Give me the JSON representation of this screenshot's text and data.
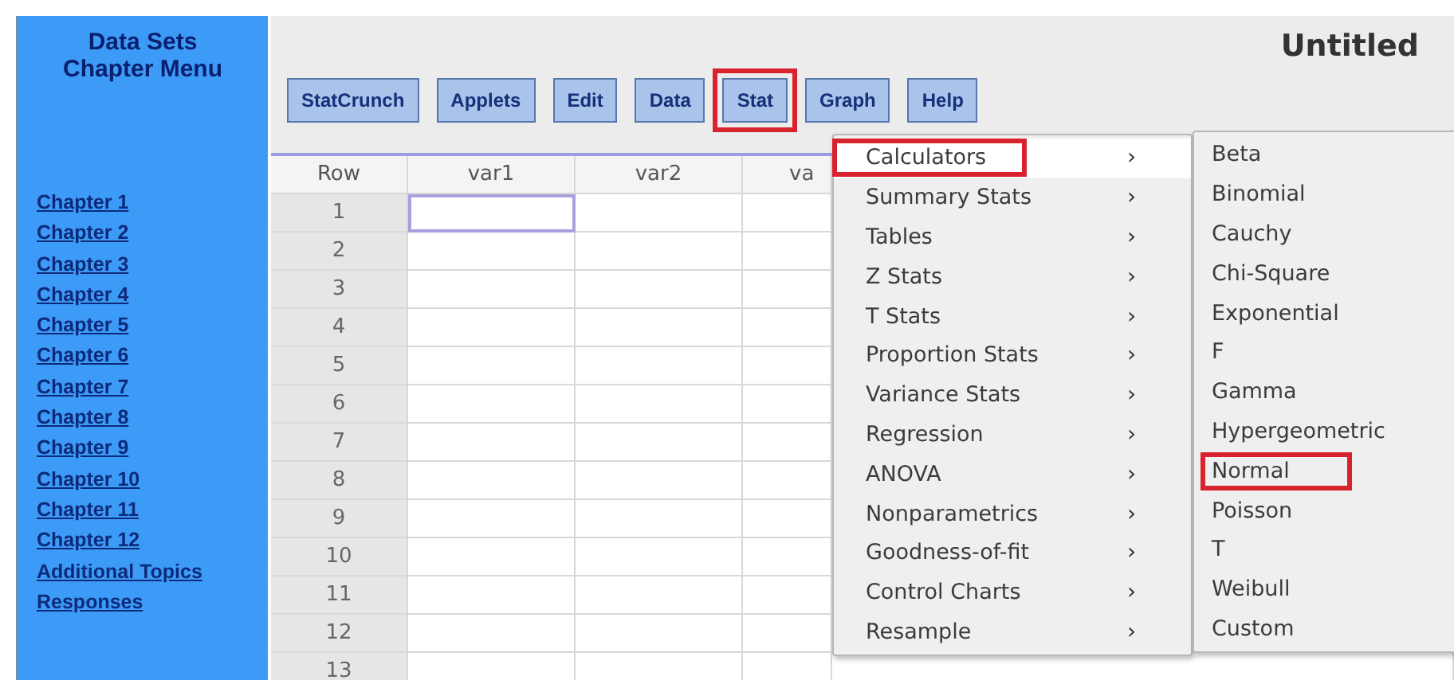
{
  "sidebar": {
    "title": "Data Sets\nChapter Menu",
    "links": [
      {
        "label": "Chapter 1"
      },
      {
        "label": "Chapter 2"
      },
      {
        "label": "Chapter 3"
      },
      {
        "label": "Chapter 4"
      },
      {
        "label": "Chapter 5"
      },
      {
        "label": "Chapter 6"
      },
      {
        "label": "Chapter 7"
      },
      {
        "label": "Chapter 8"
      },
      {
        "label": "Chapter 9"
      },
      {
        "label": "Chapter 10"
      },
      {
        "label": "Chapter 11"
      },
      {
        "label": "Chapter 12"
      },
      {
        "label": "Additional Topics"
      },
      {
        "label": "Responses"
      }
    ]
  },
  "window": {
    "title": "Untitled"
  },
  "toolbar": [
    {
      "label": "StatCrunch",
      "highlighted": false
    },
    {
      "label": "Applets",
      "highlighted": false
    },
    {
      "label": "Edit",
      "highlighted": false
    },
    {
      "label": "Data",
      "highlighted": false
    },
    {
      "label": "Stat",
      "highlighted": true
    },
    {
      "label": "Graph",
      "highlighted": false
    },
    {
      "label": "Help",
      "highlighted": false
    }
  ],
  "table": {
    "columns": [
      "Row",
      "var1",
      "var2",
      "va"
    ],
    "rows": [
      {
        "number": "1",
        "selected": true
      },
      {
        "number": "2",
        "selected": false
      },
      {
        "number": "3",
        "selected": false
      },
      {
        "number": "4",
        "selected": false
      },
      {
        "number": "5",
        "selected": false
      },
      {
        "number": "6",
        "selected": false
      },
      {
        "number": "7",
        "selected": false
      },
      {
        "number": "8",
        "selected": false
      },
      {
        "number": "9",
        "selected": false
      },
      {
        "number": "10",
        "selected": false
      },
      {
        "number": "11",
        "selected": false
      },
      {
        "number": "12",
        "selected": false
      },
      {
        "number": "13",
        "selected": false
      }
    ]
  },
  "stat_menu": {
    "items": [
      {
        "label": "Calculators",
        "arrow": "›",
        "selected": true,
        "highlighted": true
      },
      {
        "label": "Summary Stats",
        "arrow": "›",
        "selected": false,
        "highlighted": false
      },
      {
        "label": "Tables",
        "arrow": "›",
        "selected": false,
        "highlighted": false
      },
      {
        "label": "Z Stats",
        "arrow": "›",
        "selected": false,
        "highlighted": false
      },
      {
        "label": "T Stats",
        "arrow": "›",
        "selected": false,
        "highlighted": false
      },
      {
        "label": "Proportion Stats",
        "arrow": "›",
        "selected": false,
        "highlighted": false
      },
      {
        "label": "Variance Stats",
        "arrow": "›",
        "selected": false,
        "highlighted": false
      },
      {
        "label": "Regression",
        "arrow": "›",
        "selected": false,
        "highlighted": false
      },
      {
        "label": "ANOVA",
        "arrow": "›",
        "selected": false,
        "highlighted": false
      },
      {
        "label": "Nonparametrics",
        "arrow": "›",
        "selected": false,
        "highlighted": false
      },
      {
        "label": "Goodness-of-fit",
        "arrow": "›",
        "selected": false,
        "highlighted": false
      },
      {
        "label": "Control Charts",
        "arrow": "›",
        "selected": false,
        "highlighted": false
      },
      {
        "label": "Resample",
        "arrow": "›",
        "selected": false,
        "highlighted": false
      }
    ]
  },
  "calculators_menu": {
    "items": [
      {
        "label": "Beta",
        "selected": false,
        "highlighted": false
      },
      {
        "label": "Binomial",
        "selected": false,
        "highlighted": false
      },
      {
        "label": "Cauchy",
        "selected": false,
        "highlighted": false
      },
      {
        "label": "Chi-Square",
        "selected": false,
        "highlighted": false
      },
      {
        "label": "Exponential",
        "selected": false,
        "highlighted": false
      },
      {
        "label": "F",
        "selected": false,
        "highlighted": false
      },
      {
        "label": "Gamma",
        "selected": false,
        "highlighted": false
      },
      {
        "label": "Hypergeometric",
        "selected": false,
        "highlighted": false
      },
      {
        "label": "Normal",
        "selected": false,
        "highlighted": true
      },
      {
        "label": "Poisson",
        "selected": false,
        "highlighted": false
      },
      {
        "label": "T",
        "selected": false,
        "highlighted": false
      },
      {
        "label": "Weibull",
        "selected": false,
        "highlighted": false
      },
      {
        "label": "Custom",
        "selected": false,
        "highlighted": false
      }
    ]
  }
}
